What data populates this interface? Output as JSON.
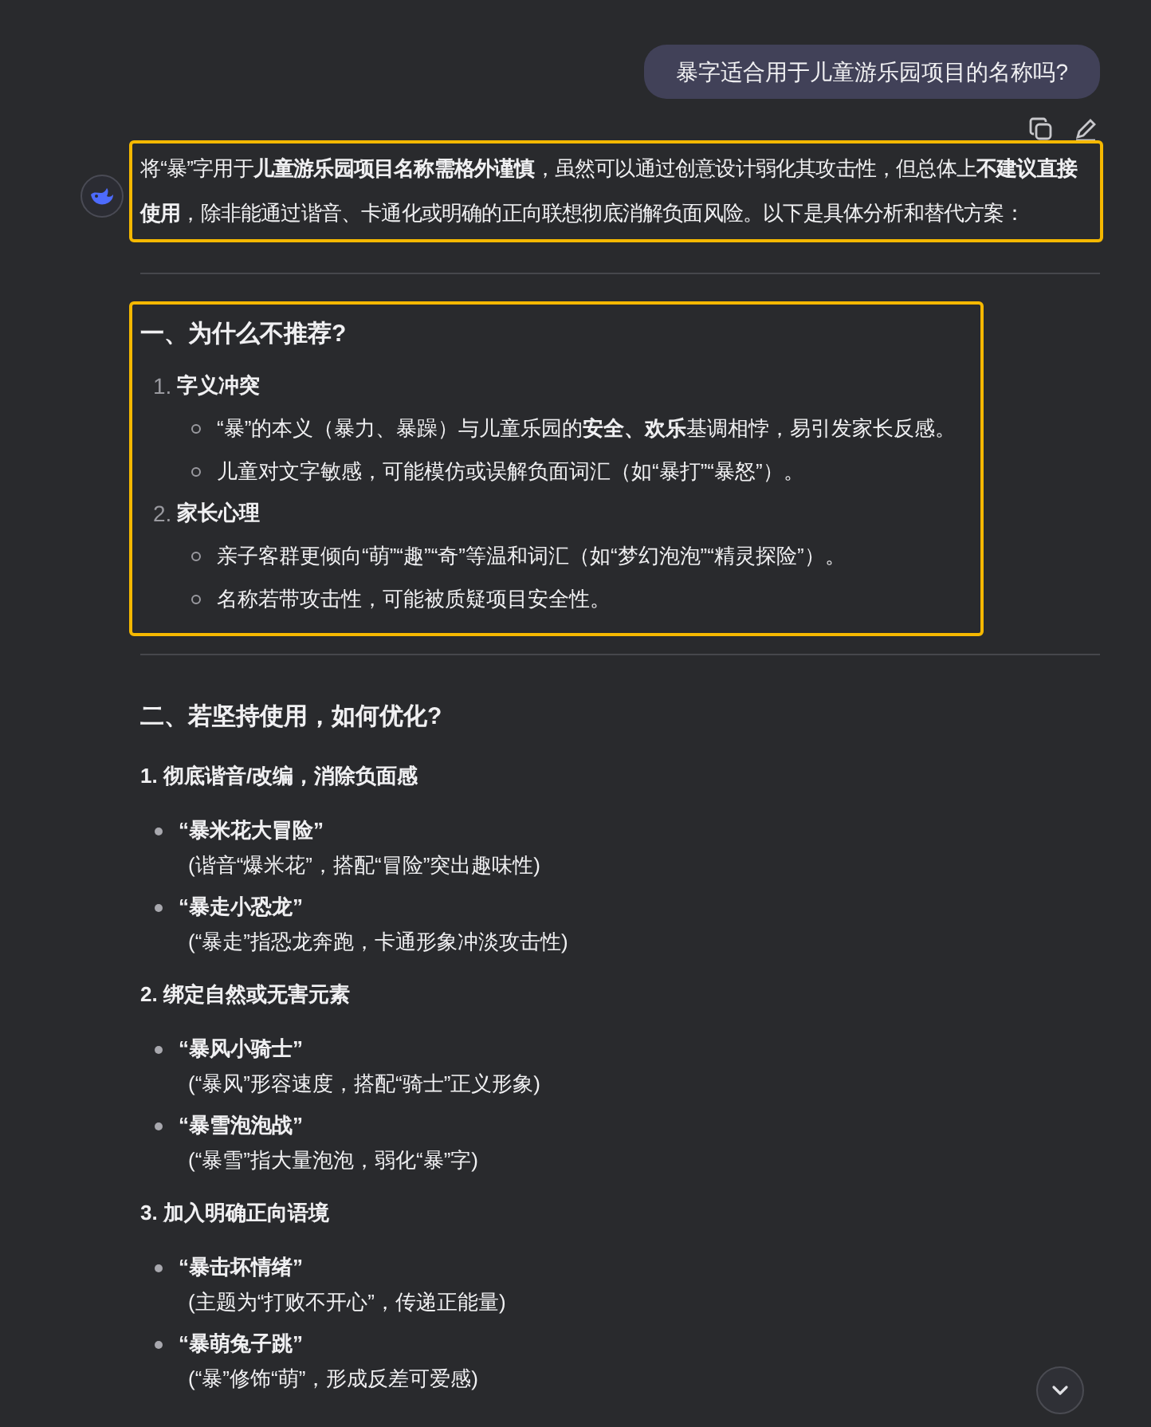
{
  "user_message": {
    "text": "暴字适合用于儿童游乐园项目的名称吗?"
  },
  "reply": {
    "intro": {
      "text": "将“暴”字用于**儿童游乐园项目名称需格外谨慎**，虽然可以通过创意设计弱化其攻击性，但总体上**不建议直接使用**，除非能通过谐音、卡通化或明确的正向联想彻底消解负面风险。以下是具体分析和替代方案：",
      "highlighted": true
    },
    "section_1": {
      "highlighted": true,
      "heading": "一、为什么不推荐?",
      "items": [
        {
          "number": "1.",
          "title": "字义冲突",
          "points": [
            "“暴”的本义（暴力、暴躁）与儿童乐园的**安全、欢乐**基调相悖，易引发家长反感。",
            "儿童对文字敏感，可能模仿或误解负面词汇（如“暴打”“暴怒”）。"
          ]
        },
        {
          "number": "2.",
          "title": "家长心理",
          "points": [
            "亲子客群更倾向“萌”“趣”“奇”等温和词汇（如“梦幻泡泡”“精灵探险”）。",
            "名称若带攻击性，可能被质疑项目安全性。"
          ]
        }
      ]
    },
    "section_2": {
      "heading": "二、若坚持使用，如何优化?",
      "groups": [
        {
          "heading": "1. 彻底谐音/改编，消除负面感",
          "items": [
            {
              "name": "“暴米花大冒险”",
              "note": "(谐音“爆米花”，搭配“冒险”突出趣味性)"
            },
            {
              "name": "“暴走小恐龙”",
              "note": "(“暴走”指恐龙奔跑，卡通形象冲淡攻击性)"
            }
          ]
        },
        {
          "heading": "2. 绑定自然或无害元素",
          "items": [
            {
              "name": "“暴风小骑士”",
              "note": "(“暴风”形容速度，搭配“骑士”正义形象)"
            },
            {
              "name": "“暴雪泡泡战”",
              "note": "(“暴雪”指大量泡泡，弱化“暴”字)"
            }
          ]
        },
        {
          "heading": "3. 加入明确正向语境",
          "items": [
            {
              "name": "“暴击坏情绪”",
              "note": "(主题为“打败不开心”，传递正能量)"
            },
            {
              "name": "“暴萌兔子跳”",
              "note": "(“暴”修饰“萌”，形成反差可爱感)"
            }
          ]
        }
      ]
    }
  }
}
